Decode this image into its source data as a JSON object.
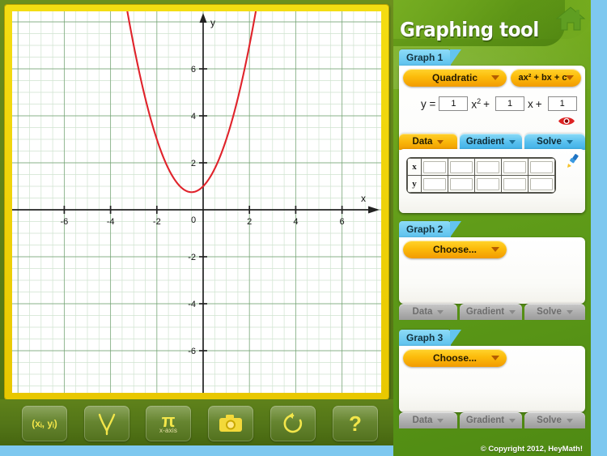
{
  "app": {
    "title": "Graphing tool",
    "copyright": "© Copyright 2012, HeyMath!"
  },
  "graph1": {
    "tab_label": "Graph 1",
    "type_dropdown": "Quadratic",
    "form_dropdown": "ax² + bx + c",
    "equation": {
      "prefix": "y =",
      "a": "1",
      "mid1": "x",
      "mid1_sup": "2",
      "plus1": "+",
      "b": "1",
      "mid2": "x",
      "plus2": "+",
      "c": "1"
    },
    "tabs": [
      {
        "label": "Data",
        "style": "orange"
      },
      {
        "label": "Gradient",
        "style": "blue"
      },
      {
        "label": "Solve",
        "style": "blue"
      }
    ],
    "table": {
      "row_x_label": "x",
      "row_y_label": "y",
      "columns": 5,
      "x_values": [
        "",
        "",
        "",
        "",
        ""
      ],
      "y_values": [
        "",
        "",
        "",
        "",
        ""
      ]
    }
  },
  "graph2": {
    "tab_label": "Graph 2",
    "type_dropdown": "Choose...",
    "tabs": [
      {
        "label": "Data",
        "style": "grey"
      },
      {
        "label": "Gradient",
        "style": "grey"
      },
      {
        "label": "Solve",
        "style": "grey"
      }
    ]
  },
  "graph3": {
    "tab_label": "Graph 3",
    "type_dropdown": "Choose...",
    "tabs": [
      {
        "label": "Data",
        "style": "grey"
      },
      {
        "label": "Gradient",
        "style": "grey"
      },
      {
        "label": "Solve",
        "style": "grey"
      }
    ]
  },
  "toolbar": {
    "buttons": [
      {
        "name": "coordinates-button",
        "glyph": "(xᵢ, yᵢ)",
        "label": ""
      },
      {
        "name": "curve-button",
        "glyph": "",
        "label": ""
      },
      {
        "name": "pi-xaxis-button",
        "glyph": "π",
        "label": "x-axis"
      },
      {
        "name": "snapshot-button",
        "glyph": "",
        "label": ""
      },
      {
        "name": "reset-button",
        "glyph": "",
        "label": ""
      },
      {
        "name": "help-button",
        "glyph": "?",
        "label": ""
      }
    ]
  },
  "chart_data": {
    "type": "line",
    "title": "",
    "xlabel": "x",
    "ylabel": "y",
    "xlim": [
      -7.6,
      7.6
    ],
    "ylim": [
      -7.6,
      7.6
    ],
    "xticks": [
      -6,
      -4,
      -2,
      0,
      2,
      4,
      6
    ],
    "yticks": [
      -6,
      -4,
      -2,
      2,
      4,
      6
    ],
    "origin_label": "0",
    "grid": true,
    "grid_minor_color": "#cfe3cf",
    "grid_major_color": "#6f9f6f",
    "series": [
      {
        "name": "y = x² + x + 1",
        "color": "#e0232b",
        "equation": {
          "a": 1,
          "b": 1,
          "c": 1
        },
        "vertex": [
          -0.5,
          0.75
        ],
        "points": [
          [
            -2.8,
            6.04
          ],
          [
            -2.5,
            4.75
          ],
          [
            -2.0,
            3.0
          ],
          [
            -1.5,
            1.75
          ],
          [
            -1.0,
            1.0
          ],
          [
            -0.5,
            0.75
          ],
          [
            0.0,
            1.0
          ],
          [
            0.5,
            1.75
          ],
          [
            1.0,
            3.0
          ],
          [
            1.5,
            4.75
          ],
          [
            2.0,
            7.0
          ],
          [
            2.3,
            8.59
          ]
        ]
      }
    ]
  }
}
